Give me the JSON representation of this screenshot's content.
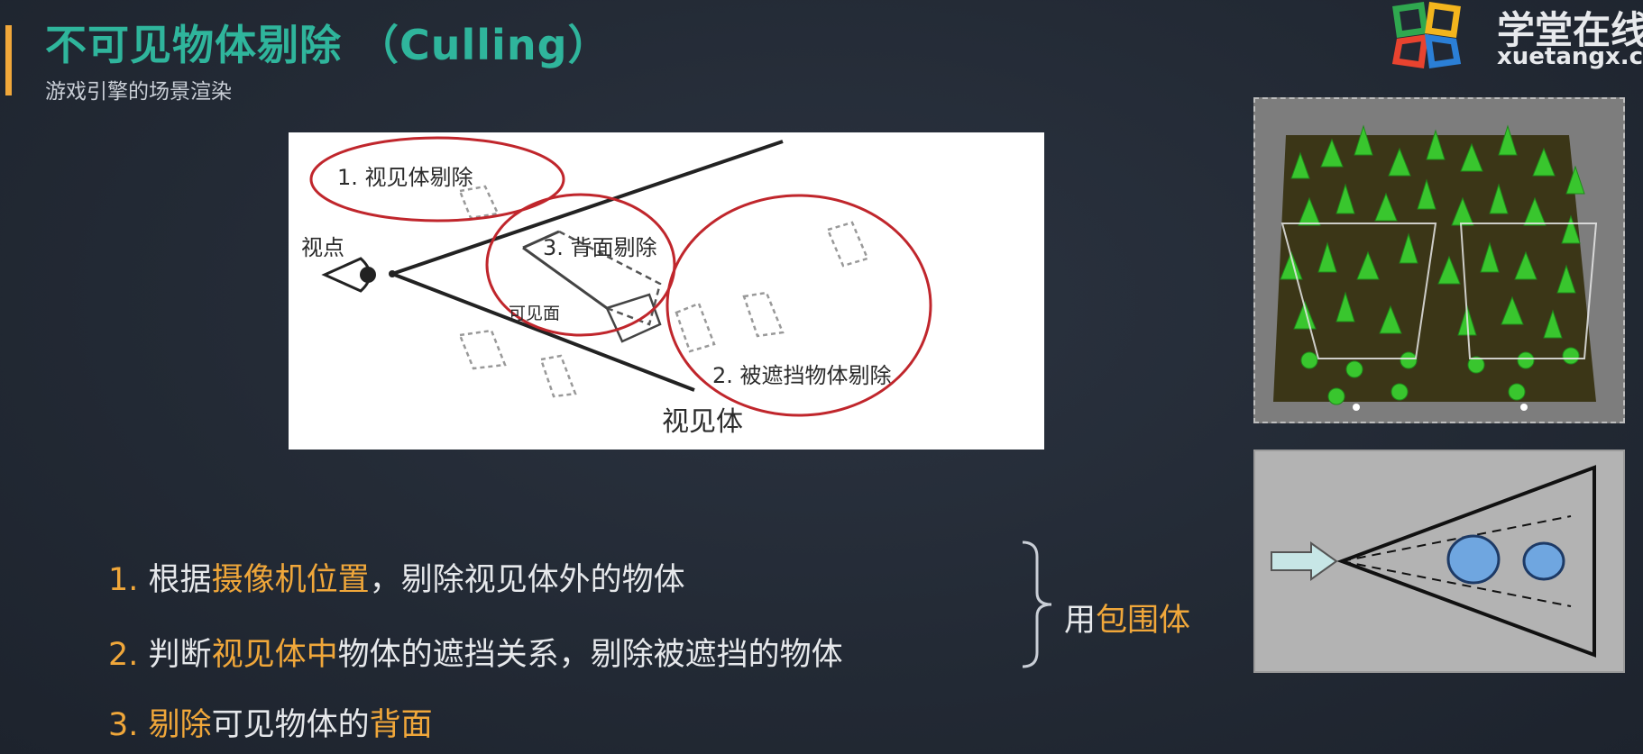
{
  "header": {
    "title": "不可见物体剔除 （Culling）",
    "subtitle": "游戏引擎的场景渲染"
  },
  "logo": {
    "name": "学堂在线",
    "url": "xuetangx.com"
  },
  "diagram": {
    "labels": {
      "frustum_culling": "1. 视见体剔除",
      "viewpoint": "视点",
      "backface_culling": "3. 背面剔除",
      "visible_face": "可见面",
      "occlusion_culling": "2. 被遮挡物体剔除",
      "view_volume": "视见体"
    }
  },
  "points": [
    {
      "num": "1.",
      "pre": "根据",
      "hl": "摄像机位置",
      "post": "，剔除视见体外的物体"
    },
    {
      "num": "2.",
      "pre": "判断",
      "hl": "视见体中",
      "post": "物体的遮挡关系，剔除被遮挡的物体"
    },
    {
      "num": "3.",
      "pre": "",
      "hl": "剔除",
      "post": "可见物体的",
      "hl2": "背面"
    }
  ],
  "brace_note": {
    "pre": "用",
    "hl": "包围体"
  },
  "colors": {
    "accent": "#f0a73a",
    "title": "#2fb59c",
    "circle": "#c0262c"
  }
}
